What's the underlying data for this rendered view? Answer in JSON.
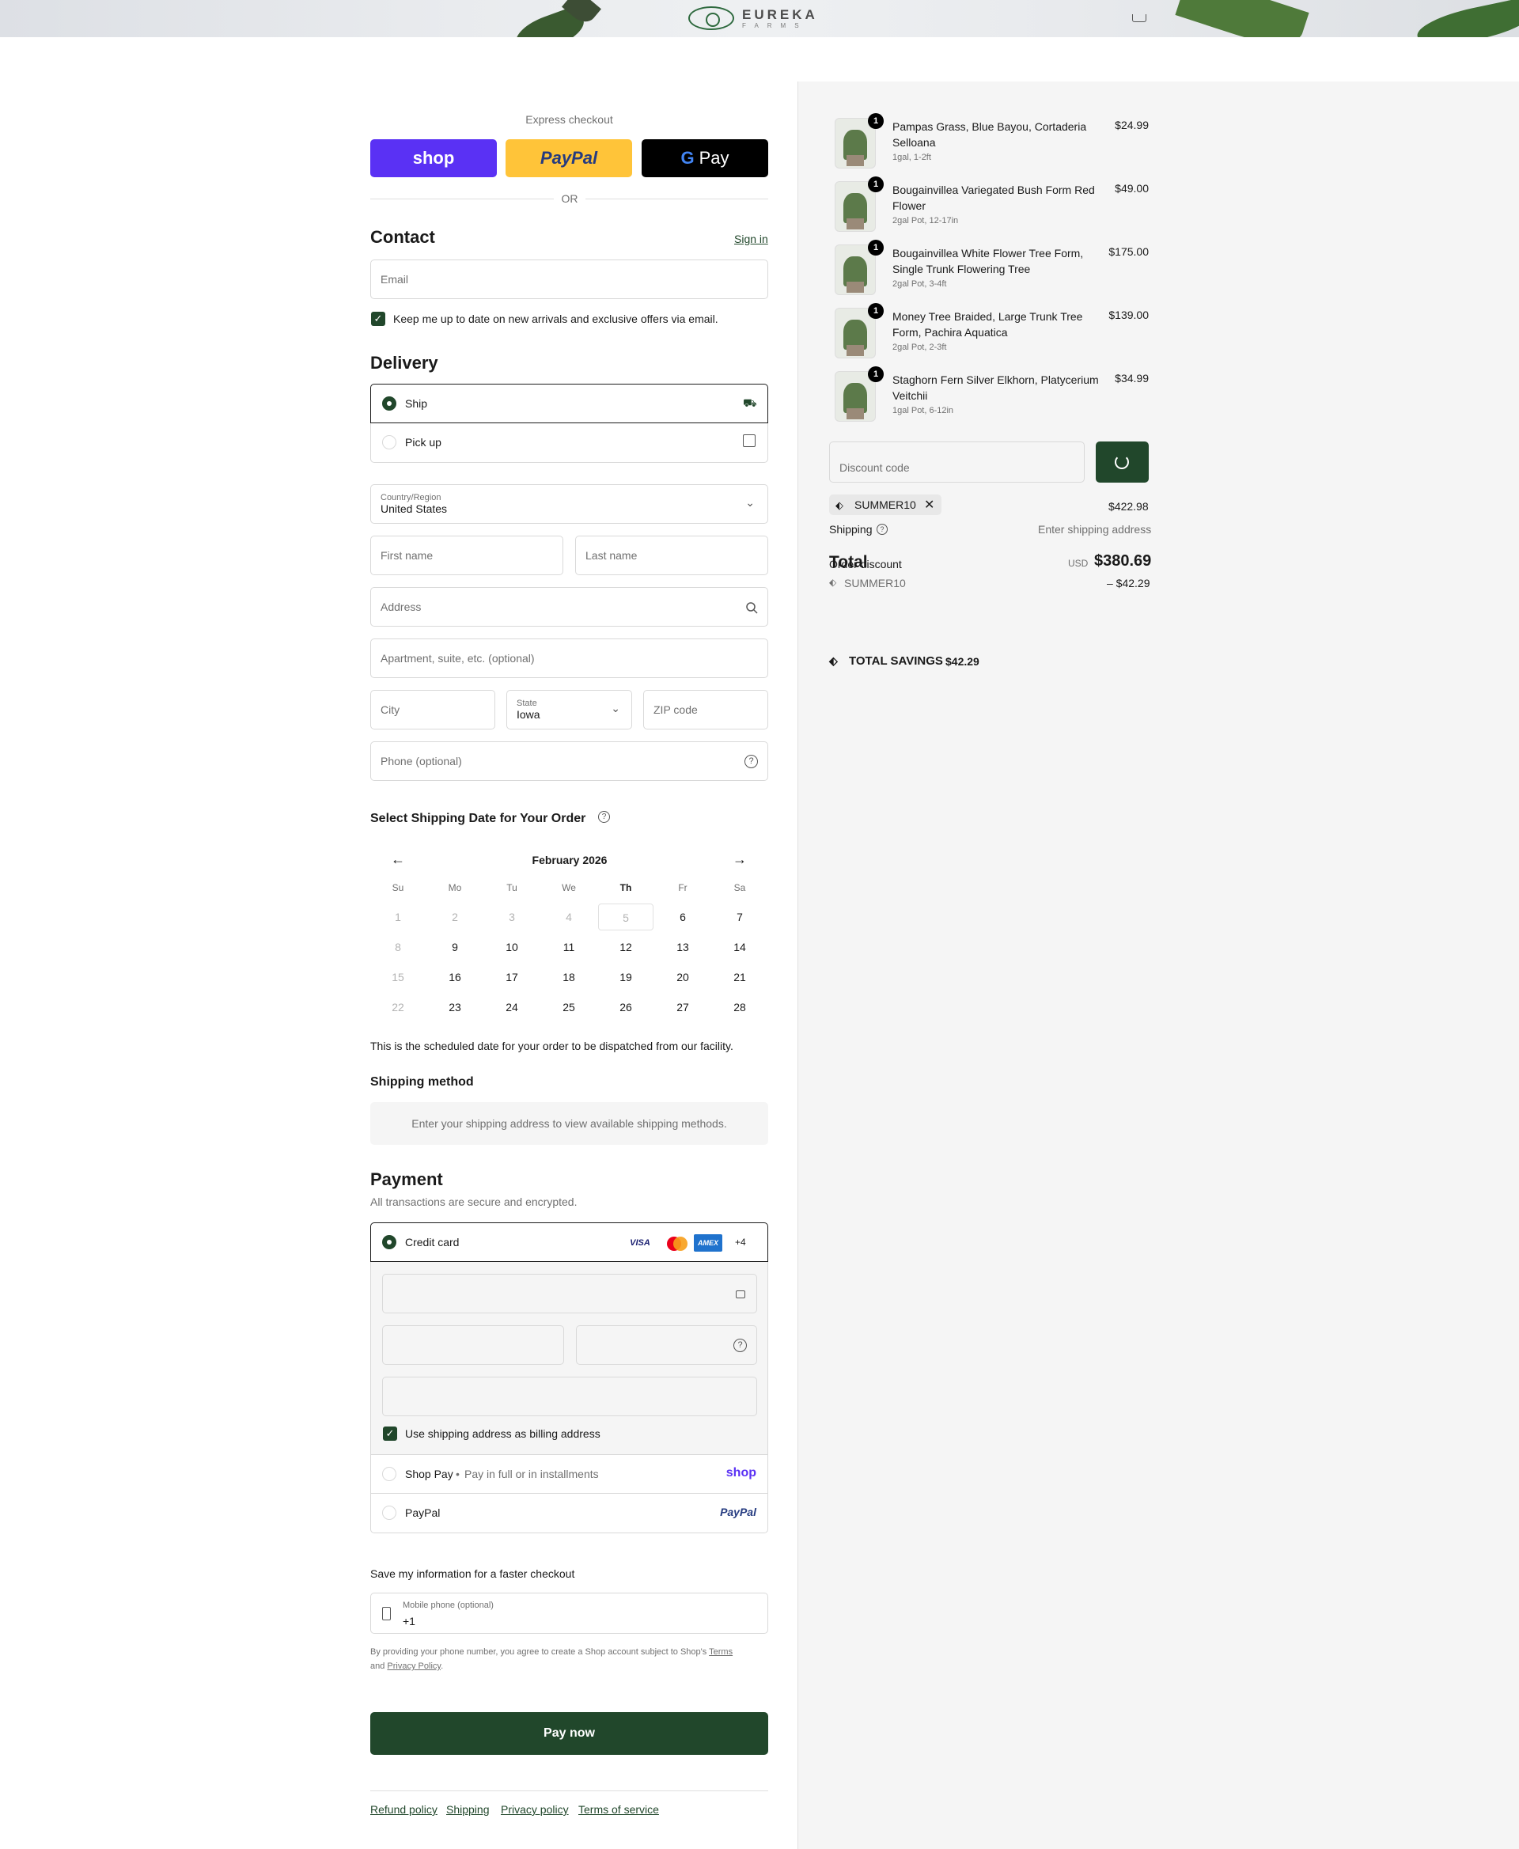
{
  "brand": {
    "name": "EUREKA",
    "tagline": "FARMS"
  },
  "express": {
    "label": "Express checkout",
    "shop": "shop",
    "paypal": "PayPal",
    "gpay": "Pay",
    "or": "OR"
  },
  "contact": {
    "title": "Contact",
    "sign_in": "Sign in",
    "email_placeholder": "Email",
    "newsletter": "Keep me up to date on new arrivals and exclusive offers via email."
  },
  "delivery": {
    "title": "Delivery",
    "options": [
      {
        "label": "Ship"
      },
      {
        "label": "Pick up"
      }
    ],
    "country_label": "Country/Region",
    "country": "United States",
    "first_name": "First name",
    "last_name": "Last name",
    "address": "Address",
    "apartment": "Apartment, suite, etc. (optional)",
    "city": "City",
    "state_label": "State",
    "state": "Iowa",
    "zip": "ZIP code",
    "phone": "Phone (optional)"
  },
  "shipping_date": {
    "title": "Select Shipping Date for Your Order",
    "month": "February 2026",
    "weekdays": [
      "Su",
      "Mo",
      "Tu",
      "We",
      "Th",
      "Fr",
      "Sa"
    ],
    "weeks": [
      [
        {
          "d": "1",
          "dim": true
        },
        {
          "d": "2",
          "dim": true
        },
        {
          "d": "3",
          "dim": true
        },
        {
          "d": "4",
          "dim": true
        },
        {
          "d": "5",
          "dim": true,
          "today": true
        },
        {
          "d": "6"
        },
        {
          "d": "7"
        }
      ],
      [
        {
          "d": "8",
          "dim": true
        },
        {
          "d": "9"
        },
        {
          "d": "10"
        },
        {
          "d": "11"
        },
        {
          "d": "12"
        },
        {
          "d": "13"
        },
        {
          "d": "14"
        }
      ],
      [
        {
          "d": "15",
          "dim": true
        },
        {
          "d": "16"
        },
        {
          "d": "17"
        },
        {
          "d": "18"
        },
        {
          "d": "19"
        },
        {
          "d": "20"
        },
        {
          "d": "21"
        }
      ],
      [
        {
          "d": "22",
          "dim": true
        },
        {
          "d": "23"
        },
        {
          "d": "24"
        },
        {
          "d": "25"
        },
        {
          "d": "26"
        },
        {
          "d": "27"
        },
        {
          "d": "28"
        }
      ]
    ],
    "note": "This is the scheduled date for your order to be dispatched from our facility."
  },
  "shipping_method": {
    "title": "Shipping method",
    "empty": "Enter your shipping address to view available shipping methods."
  },
  "payment": {
    "title": "Payment",
    "subtitle": "All transactions are secure and encrypted.",
    "credit_card": "Credit card",
    "card_visa": "VISA",
    "card_amex": "AMEX",
    "card_more": "+4",
    "billing_same": "Use shipping address as billing address",
    "shop_pay": "Shop Pay",
    "shop_pay_sub": "Pay in full or in installments",
    "shop_logo": "shop",
    "paypal": "PayPal",
    "paypal_logo": "PayPal"
  },
  "save_info": {
    "title": "Save my information for a faster checkout",
    "mobile_label": "Mobile phone (optional)",
    "mobile_value": "+1",
    "legal_1": "By providing your phone number, you agree to create a Shop account subject to Shop's ",
    "terms": "Terms",
    "legal_2": "and ",
    "privacy": "Privacy Policy",
    "legal_3": "."
  },
  "pay_now": "Pay now",
  "footer": [
    "Refund policy",
    "Shipping",
    "Privacy policy",
    "Terms of service"
  ],
  "order": {
    "items": [
      {
        "qty": "1",
        "name": "Pampas Grass, Blue Bayou, Cortaderia Selloana",
        "variant": "1gal, 1-2ft",
        "price": "$24.99"
      },
      {
        "qty": "1",
        "name": "Bougainvillea Variegated Bush Form Red Flower",
        "variant": "2gal Pot, 12-17in",
        "price": "$49.00"
      },
      {
        "qty": "1",
        "name": "Bougainvillea White Flower Tree Form, Single Trunk Flowering Tree",
        "variant": "2gal Pot, 3-4ft",
        "price": "$175.00"
      },
      {
        "qty": "1",
        "name": "Money Tree Braided, Large Trunk Tree Form, Pachira Aquatica",
        "variant": "2gal Pot, 2-3ft",
        "price": "$139.00"
      },
      {
        "qty": "1",
        "name": "Staghorn Fern Silver Elkhorn, Platycerium Veitchii",
        "variant": "1gal Pot, 6-12in",
        "price": "$34.99"
      }
    ],
    "discount_placeholder": "Discount code",
    "applied_code": "SUMMER10",
    "subtotal": "$422.98",
    "shipping_label": "Shipping",
    "shipping_value": "Enter shipping address",
    "total_label": "Total",
    "order_discount": "Order discount",
    "currency": "USD",
    "total": "$380.69",
    "discount_code": "SUMMER10",
    "discount_amount": "– $42.29",
    "savings_label": "TOTAL SAVINGS",
    "savings": "$42.29"
  },
  "colors": {
    "primary": "#21472b",
    "shop": "#5a31f4",
    "paypal": "#ffc439"
  }
}
